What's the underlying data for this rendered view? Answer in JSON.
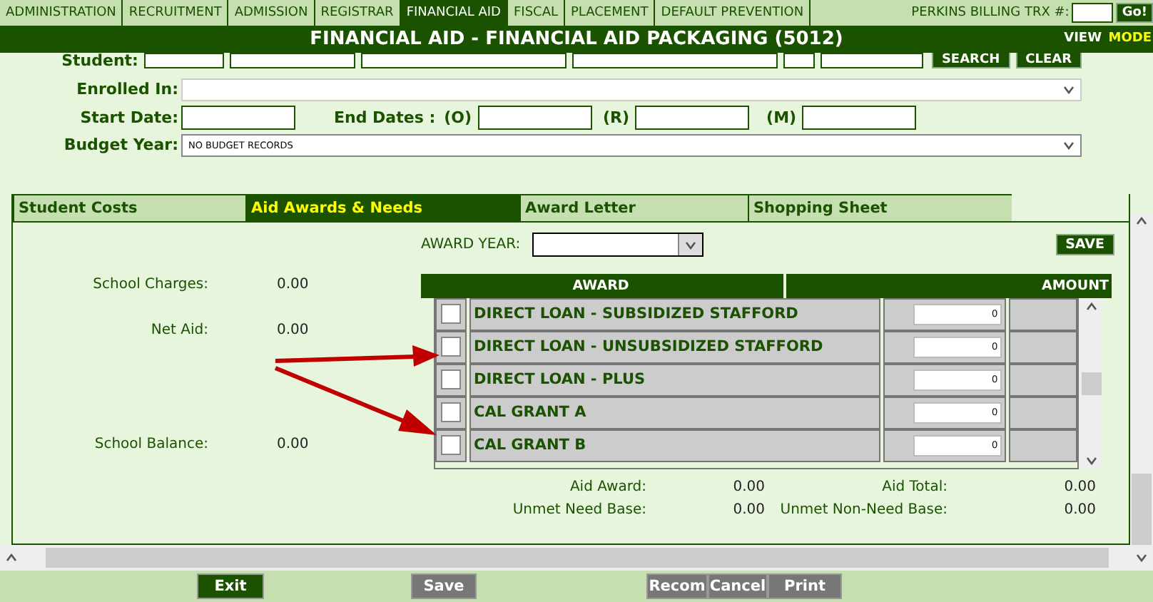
{
  "nav": {
    "items": [
      {
        "label": "ADMINISTRATION",
        "selected": false
      },
      {
        "label": "RECRUITMENT",
        "selected": false
      },
      {
        "label": "ADMISSION",
        "selected": false
      },
      {
        "label": "REGISTRAR",
        "selected": false
      },
      {
        "label": "FINANCIAL AID",
        "selected": true
      },
      {
        "label": "FISCAL",
        "selected": false
      },
      {
        "label": "PLACEMENT",
        "selected": false
      },
      {
        "label": "DEFAULT PREVENTION",
        "selected": false
      }
    ],
    "trx_label": "PERKINS BILLING TRX #:",
    "go_button": "Go!"
  },
  "title_bar": {
    "title": "FINANCIAL AID - FINANCIAL AID PACKAGING (5012)",
    "view": "VIEW",
    "mode": "MODE"
  },
  "form": {
    "student_label": "Student:",
    "search_button": "SEARCH",
    "clear_button": "CLEAR",
    "enrolled_label": "Enrolled In:",
    "start_label": "Start Date:",
    "end_label": "End Dates :",
    "end_o": "(O)",
    "end_r": "(R)",
    "end_m": "(M)",
    "budget_label": "Budget Year:",
    "budget_value": "NO BUDGET RECORDS"
  },
  "tabs": [
    {
      "label": "Student Costs",
      "selected": false
    },
    {
      "label": "Aid Awards & Needs",
      "selected": true
    },
    {
      "label": "Award Letter",
      "selected": false
    },
    {
      "label": "Shopping Sheet",
      "selected": false
    }
  ],
  "stats": [
    {
      "label": "School Charges:",
      "value": "0.00"
    },
    {
      "label": "Net Aid:",
      "value": "0.00"
    },
    {
      "label": "School Balance:",
      "value": "0.00"
    }
  ],
  "award_year_label": "AWARD YEAR:",
  "save_button": "SAVE",
  "table": {
    "columns": [
      "AWARD",
      "AMOUNT"
    ],
    "rows": [
      {
        "award": "DIRECT LOAN - SUBSIDIZED STAFFORD",
        "amount": "0",
        "checked": false
      },
      {
        "award": "DIRECT LOAN - UNSUBSIDIZED STAFFORD",
        "amount": "0",
        "checked": false
      },
      {
        "award": "DIRECT LOAN - PLUS",
        "amount": "0",
        "checked": false
      },
      {
        "award": "CAL GRANT A",
        "amount": "0",
        "checked": false
      },
      {
        "award": "CAL GRANT B",
        "amount": "0",
        "checked": false
      }
    ]
  },
  "summary": [
    {
      "label": "Aid Award:",
      "value": "0.00",
      "label2": "Aid Total:",
      "value2": "0.00"
    },
    {
      "label": "Unmet Need Base:",
      "value": "0.00",
      "label2": "Unmet Non-Need Base:",
      "value2": "0.00"
    }
  ],
  "footer_buttons": [
    {
      "label": "Exit",
      "kind": "primary"
    },
    {
      "label": "Save",
      "kind": "grey"
    },
    {
      "label": "Recom",
      "kind": "grey"
    },
    {
      "label": "Cancel",
      "kind": "grey"
    },
    {
      "label": "Print",
      "kind": "grey"
    }
  ]
}
